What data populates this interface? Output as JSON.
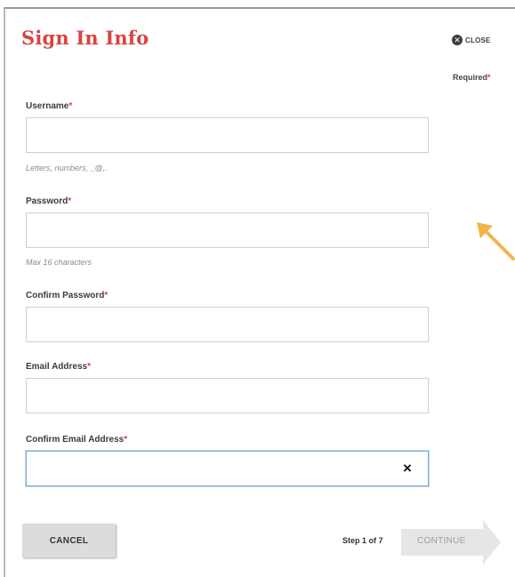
{
  "dialog": {
    "title": "Sign In Info",
    "close_label": "CLOSE",
    "required_note": "Required",
    "required_marker": "*"
  },
  "fields": {
    "username": {
      "label": "Username",
      "value": "",
      "hint": "Letters, numbers, _@,."
    },
    "password": {
      "label": "Password",
      "value": "",
      "hint": "Max 16 characters"
    },
    "confirm_password": {
      "label": "Confirm Password",
      "value": ""
    },
    "email": {
      "label": "Email Address",
      "value": ""
    },
    "confirm_email": {
      "label": "Confirm Email Address",
      "value": "",
      "clear_symbol": "×"
    }
  },
  "footer": {
    "cancel_label": "CANCEL",
    "step_text": "Step 1 of 7",
    "continue_label": "CONTINUE"
  },
  "colors": {
    "title": "#d9433f",
    "required_star": "#d9433f",
    "annotation_arrow": "#f3b54a",
    "continue_arrow": "#e6e6e6",
    "focus_border": "#7ea6d8"
  },
  "icons": {
    "close": "close-circle-icon",
    "clear": "clear-x-icon",
    "annotation": "annotation-arrow-icon"
  }
}
